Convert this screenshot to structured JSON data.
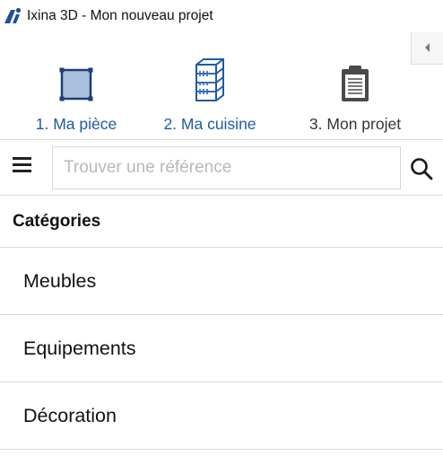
{
  "window": {
    "title": "Ixina 3D - Mon nouveau projet"
  },
  "steps": [
    {
      "label": "1. Ma pièce",
      "icon": "room-square-icon",
      "color": "#1f5aa6"
    },
    {
      "label": "2. Ma cuisine",
      "icon": "kitchen-cabinet-icon",
      "color": "#1f5aa6"
    },
    {
      "label": "3. Mon projet",
      "icon": "clipboard-icon",
      "color": "#333333"
    }
  ],
  "search": {
    "placeholder": "Trouver une référence",
    "value": ""
  },
  "categories": {
    "header": "Catégories",
    "items": [
      {
        "label": "Meubles"
      },
      {
        "label": "Equipements"
      },
      {
        "label": "Décoration"
      }
    ]
  },
  "colors": {
    "accent": "#1f5aa6",
    "divider": "#dcdcdc",
    "room_fill": "#a9c1de"
  }
}
